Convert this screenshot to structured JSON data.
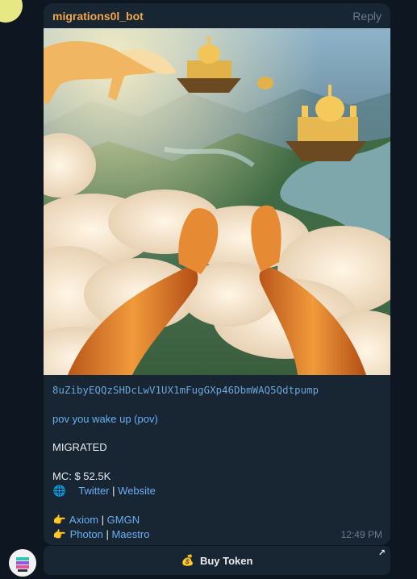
{
  "message": {
    "sender": "migrations0l_bot",
    "reply_label": "Reply",
    "contract_address": "8uZibyEQQzSHDcLwV1UX1mFugGXp46DbmWAQ5Qdtpump",
    "token_name": "pov you wake up (pov)",
    "status": "MIGRATED",
    "mc_label": "MC: $ 52.5K",
    "globe_icon": "globe-icon",
    "twitter_label": "Twitter",
    "separator": "|",
    "website_label": "Website",
    "pointer_icon": "pointing-hand-icon",
    "axiom_label": "Axiom",
    "gmgn_label": "GMGN",
    "photon_label": "Photon",
    "maestro_label": "Maestro",
    "time": "12:49 PM"
  },
  "button": {
    "label": "Buy Token",
    "icon": "money-bag-icon",
    "arrow_icon": "external-arrow-icon"
  },
  "colors": {
    "background": "#0e1621",
    "bubble": "#182533",
    "sender": "#f0a84b",
    "link": "#6ab0f3"
  }
}
